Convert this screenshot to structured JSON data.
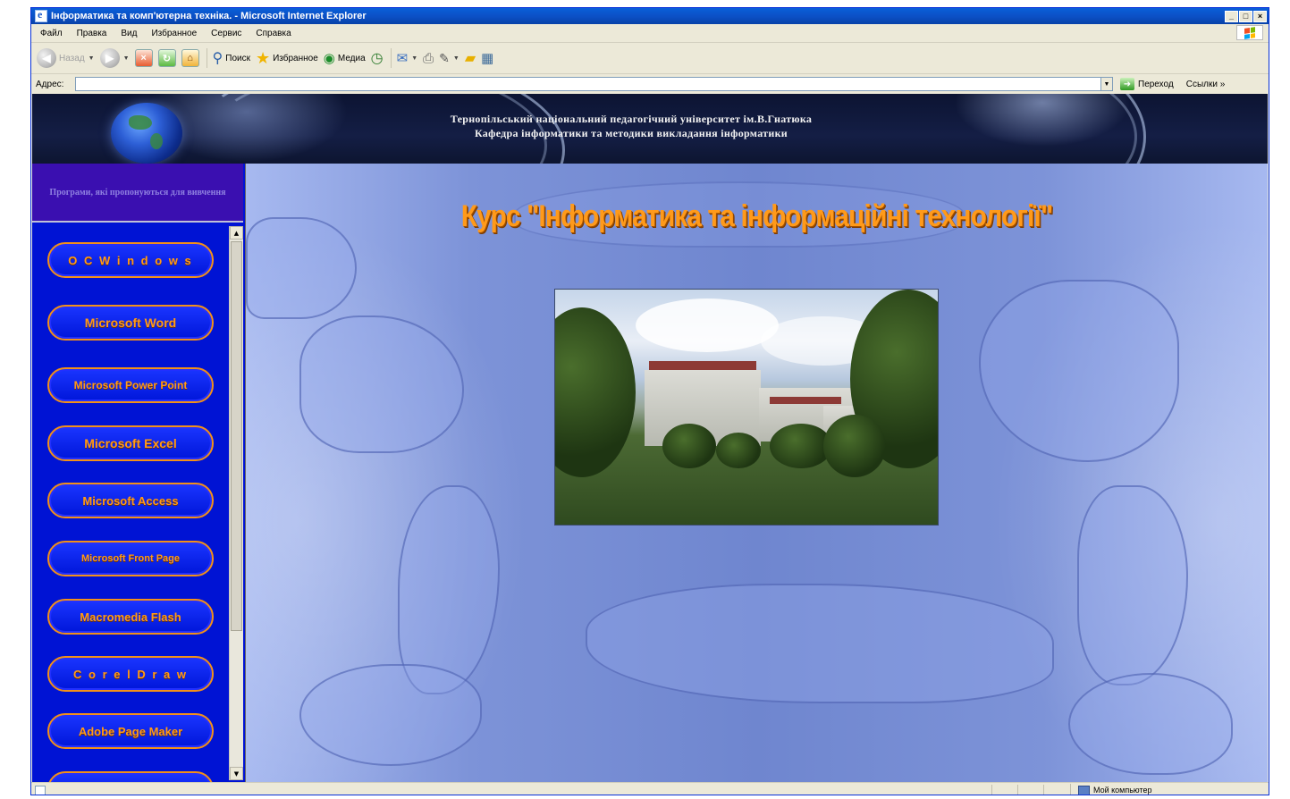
{
  "window": {
    "title": "Інформатика та комп'ютерна техніка. - Microsoft Internet Explorer",
    "controls": {
      "minimize": "_",
      "maximize": "□",
      "close": "×"
    }
  },
  "menu": [
    "Файл",
    "Правка",
    "Вид",
    "Избранное",
    "Сервис",
    "Справка"
  ],
  "toolbar": {
    "back": "Назад",
    "search": "Поиск",
    "favorites": "Избранное",
    "media": "Медиа"
  },
  "addressbar": {
    "label": "Адрес:",
    "value": "",
    "go": "Переход",
    "links": "Ссылки"
  },
  "banner": {
    "line1": "Тернопільський національний педагогічний університет ім.В.Гнатюка",
    "line2": "Кафедра інформатики та методики викладання інформатики"
  },
  "sidebar": {
    "header": "Програми, які пропонуються для вивчення",
    "items": [
      {
        "label": "О С   W i n d o w s"
      },
      {
        "label": "Microsoft Word"
      },
      {
        "label": "Microsoft Power Point"
      },
      {
        "label": "Microsoft Excel"
      },
      {
        "label": "Microsoft Access"
      },
      {
        "label": "Microsoft Front Page"
      },
      {
        "label": "Macromedia Flash"
      },
      {
        "label": "C o r e l   D r a w"
      },
      {
        "label": "Adobe Page Maker"
      }
    ]
  },
  "main": {
    "course_title": "Курс \"Інформатика та інформаційні технології\""
  },
  "status": {
    "zone": "Мой компьютер"
  },
  "colors": {
    "sidebar_bg": "#0013d4",
    "button_border": "#f29018",
    "button_text": "#ff9a1a",
    "title_text": "#ff9a1a",
    "banner_bg": "#141e45",
    "xp_titlebar": "#0b4fc4"
  }
}
